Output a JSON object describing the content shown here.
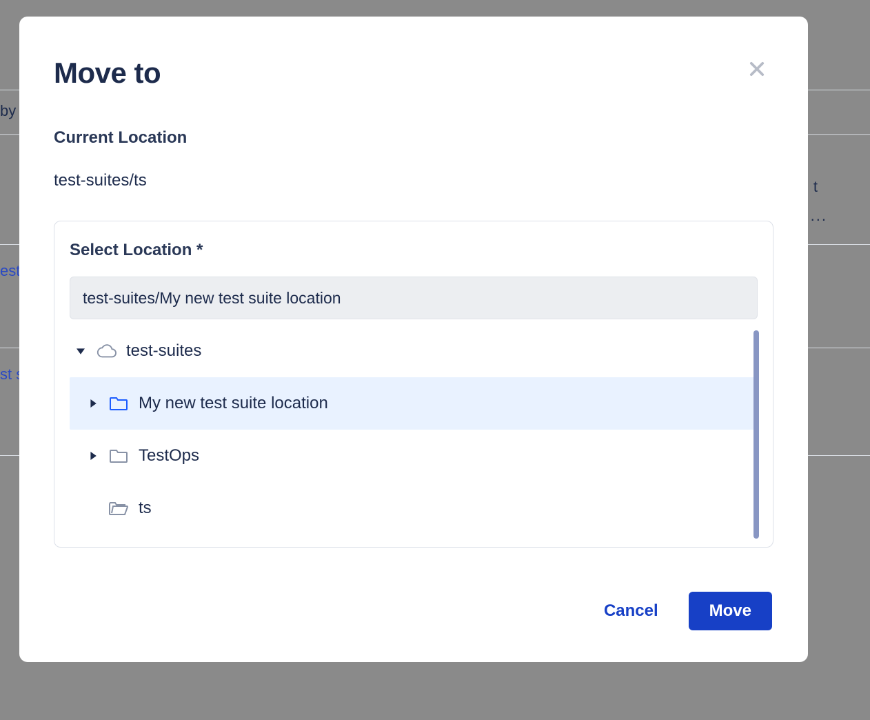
{
  "background": {
    "truncated_left_1": "by",
    "truncated_left_2": "est",
    "truncated_left_3": "st s",
    "truncated_right_1": "t",
    "truncated_right_2": "..."
  },
  "modal": {
    "title": "Move to",
    "current_location_label": "Current Location",
    "current_location_path": "test-suites/ts",
    "select_location_label": "Select Location *",
    "selected_path": "test-suites/My new test suite location",
    "tree": {
      "root": {
        "label": "test-suites",
        "icon": "cloud"
      },
      "children": [
        {
          "label": "My new test suite location",
          "icon": "folder",
          "selected": true,
          "expandable": true,
          "color": "blue"
        },
        {
          "label": "TestOps",
          "icon": "folder",
          "selected": false,
          "expandable": true,
          "color": "gray"
        },
        {
          "label": "ts",
          "icon": "folder-open",
          "selected": false,
          "expandable": false,
          "color": "gray"
        }
      ]
    },
    "buttons": {
      "cancel": "Cancel",
      "move": "Move"
    }
  }
}
